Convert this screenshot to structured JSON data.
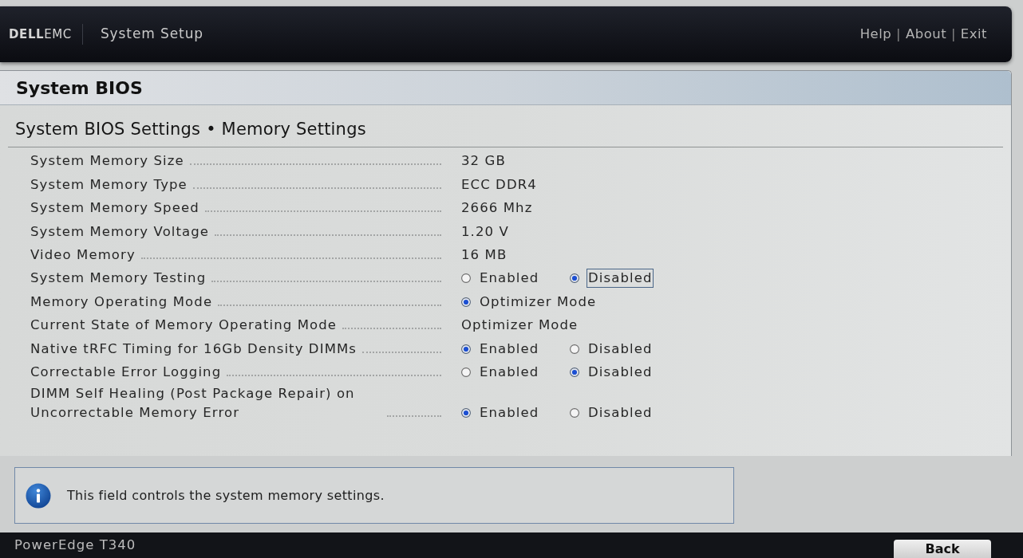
{
  "header": {
    "logo": "**DELL**EMC",
    "title": "System Setup",
    "links": [
      {
        "label": "Help",
        "separator": "|"
      },
      {
        "label": "About",
        "separator": "|"
      },
      {
        "label": "Exit"
      }
    ]
  },
  "page_title": "System BIOS",
  "breadcrumb": "System BIOS Settings • Memory Settings",
  "settings": [
    {
      "kind": "value",
      "label": "System Memory Size",
      "value": "32 GB"
    },
    {
      "kind": "value",
      "label": "System Memory Type",
      "value": "ECC DDR4"
    },
    {
      "kind": "value",
      "label": "System Memory Speed",
      "value": "2666 Mhz"
    },
    {
      "kind": "value",
      "label": "System Memory Voltage",
      "value": "1.20 V"
    },
    {
      "kind": "value",
      "label": "Video Memory",
      "value": "16 MB"
    },
    {
      "kind": "radio",
      "label": "System Memory Testing",
      "options": [
        {
          "label": "Enabled",
          "selected": false,
          "focused": false
        },
        {
          "label": "Disabled",
          "selected": true,
          "focused": true
        }
      ]
    },
    {
      "kind": "radio",
      "label": "Memory Operating Mode",
      "options": [
        {
          "label": "Optimizer Mode",
          "selected": true,
          "focused": false
        }
      ]
    },
    {
      "kind": "value",
      "label": "Current State of Memory Operating Mode",
      "value": "Optimizer Mode"
    },
    {
      "kind": "radio",
      "label": "Native tRFC Timing for 16Gb Density DIMMs",
      "options": [
        {
          "label": "Enabled",
          "selected": true,
          "focused": false
        },
        {
          "label": "Disabled",
          "selected": false,
          "focused": false
        }
      ]
    },
    {
      "kind": "radio",
      "label": "Correctable Error Logging",
      "options": [
        {
          "label": "Enabled",
          "selected": false,
          "focused": false
        },
        {
          "label": "Disabled",
          "selected": true,
          "focused": false
        }
      ]
    },
    {
      "kind": "radio",
      "label": "DIMM Self Healing (Post Package Repair) on Uncorrectable Memory Error",
      "options": [
        {
          "label": "Enabled",
          "selected": true,
          "focused": false
        },
        {
          "label": "Disabled",
          "selected": false,
          "focused": false
        }
      ]
    }
  ],
  "help_box": {
    "text": "This field controls the system memory settings."
  },
  "footer": {
    "model": "PowerEdge T340",
    "buttons": [
      "Back"
    ]
  }
}
